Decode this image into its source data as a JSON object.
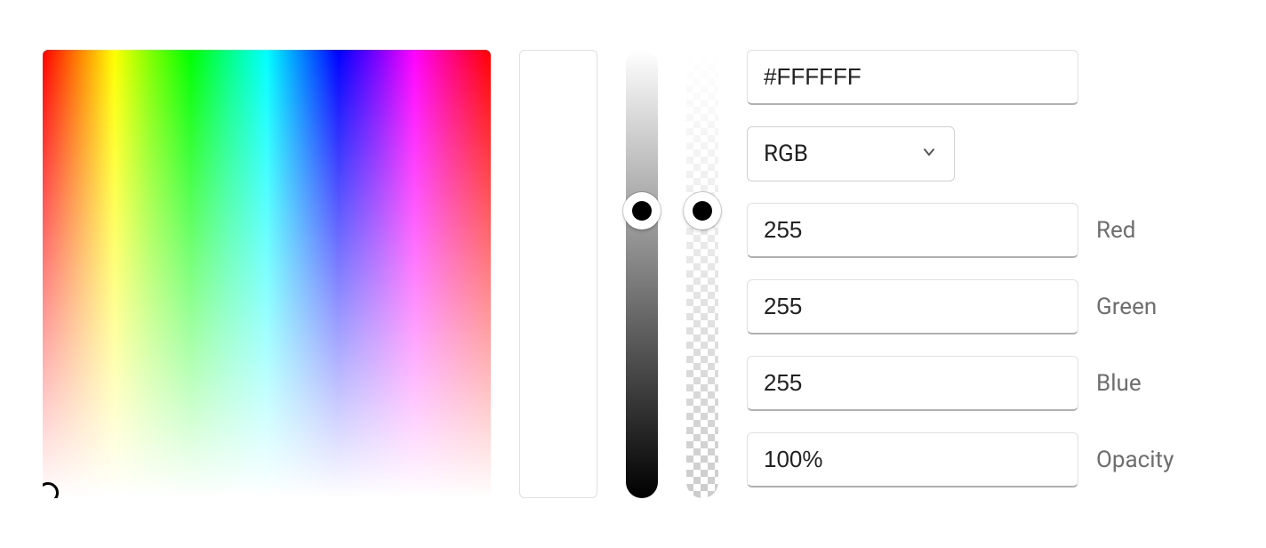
{
  "hex": {
    "value": "#FFFFFF"
  },
  "format": {
    "selected": "RGB"
  },
  "channels": {
    "red": {
      "label": "Red",
      "value": "255"
    },
    "green": {
      "label": "Green",
      "value": "255"
    },
    "blue": {
      "label": "Blue",
      "value": "255"
    }
  },
  "opacity": {
    "label": "Opacity",
    "value": "100%"
  }
}
